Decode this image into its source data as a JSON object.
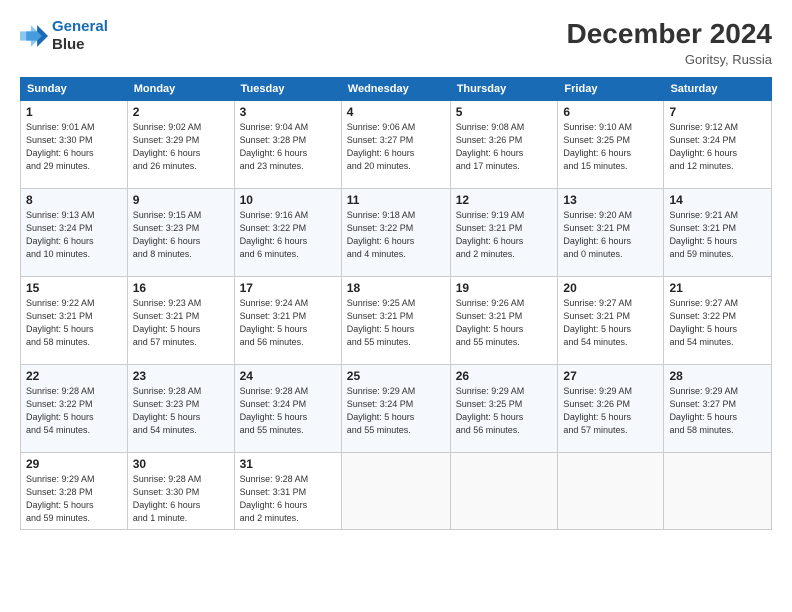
{
  "header": {
    "logo_line1": "General",
    "logo_line2": "Blue",
    "month": "December 2024",
    "location": "Goritsy, Russia"
  },
  "days_of_week": [
    "Sunday",
    "Monday",
    "Tuesday",
    "Wednesday",
    "Thursday",
    "Friday",
    "Saturday"
  ],
  "weeks": [
    [
      {
        "day": "1",
        "info": "Sunrise: 9:01 AM\nSunset: 3:30 PM\nDaylight: 6 hours\nand 29 minutes."
      },
      {
        "day": "2",
        "info": "Sunrise: 9:02 AM\nSunset: 3:29 PM\nDaylight: 6 hours\nand 26 minutes."
      },
      {
        "day": "3",
        "info": "Sunrise: 9:04 AM\nSunset: 3:28 PM\nDaylight: 6 hours\nand 23 minutes."
      },
      {
        "day": "4",
        "info": "Sunrise: 9:06 AM\nSunset: 3:27 PM\nDaylight: 6 hours\nand 20 minutes."
      },
      {
        "day": "5",
        "info": "Sunrise: 9:08 AM\nSunset: 3:26 PM\nDaylight: 6 hours\nand 17 minutes."
      },
      {
        "day": "6",
        "info": "Sunrise: 9:10 AM\nSunset: 3:25 PM\nDaylight: 6 hours\nand 15 minutes."
      },
      {
        "day": "7",
        "info": "Sunrise: 9:12 AM\nSunset: 3:24 PM\nDaylight: 6 hours\nand 12 minutes."
      }
    ],
    [
      {
        "day": "8",
        "info": "Sunrise: 9:13 AM\nSunset: 3:24 PM\nDaylight: 6 hours\nand 10 minutes."
      },
      {
        "day": "9",
        "info": "Sunrise: 9:15 AM\nSunset: 3:23 PM\nDaylight: 6 hours\nand 8 minutes."
      },
      {
        "day": "10",
        "info": "Sunrise: 9:16 AM\nSunset: 3:22 PM\nDaylight: 6 hours\nand 6 minutes."
      },
      {
        "day": "11",
        "info": "Sunrise: 9:18 AM\nSunset: 3:22 PM\nDaylight: 6 hours\nand 4 minutes."
      },
      {
        "day": "12",
        "info": "Sunrise: 9:19 AM\nSunset: 3:21 PM\nDaylight: 6 hours\nand 2 minutes."
      },
      {
        "day": "13",
        "info": "Sunrise: 9:20 AM\nSunset: 3:21 PM\nDaylight: 6 hours\nand 0 minutes."
      },
      {
        "day": "14",
        "info": "Sunrise: 9:21 AM\nSunset: 3:21 PM\nDaylight: 5 hours\nand 59 minutes."
      }
    ],
    [
      {
        "day": "15",
        "info": "Sunrise: 9:22 AM\nSunset: 3:21 PM\nDaylight: 5 hours\nand 58 minutes."
      },
      {
        "day": "16",
        "info": "Sunrise: 9:23 AM\nSunset: 3:21 PM\nDaylight: 5 hours\nand 57 minutes."
      },
      {
        "day": "17",
        "info": "Sunrise: 9:24 AM\nSunset: 3:21 PM\nDaylight: 5 hours\nand 56 minutes."
      },
      {
        "day": "18",
        "info": "Sunrise: 9:25 AM\nSunset: 3:21 PM\nDaylight: 5 hours\nand 55 minutes."
      },
      {
        "day": "19",
        "info": "Sunrise: 9:26 AM\nSunset: 3:21 PM\nDaylight: 5 hours\nand 55 minutes."
      },
      {
        "day": "20",
        "info": "Sunrise: 9:27 AM\nSunset: 3:21 PM\nDaylight: 5 hours\nand 54 minutes."
      },
      {
        "day": "21",
        "info": "Sunrise: 9:27 AM\nSunset: 3:22 PM\nDaylight: 5 hours\nand 54 minutes."
      }
    ],
    [
      {
        "day": "22",
        "info": "Sunrise: 9:28 AM\nSunset: 3:22 PM\nDaylight: 5 hours\nand 54 minutes."
      },
      {
        "day": "23",
        "info": "Sunrise: 9:28 AM\nSunset: 3:23 PM\nDaylight: 5 hours\nand 54 minutes."
      },
      {
        "day": "24",
        "info": "Sunrise: 9:28 AM\nSunset: 3:24 PM\nDaylight: 5 hours\nand 55 minutes."
      },
      {
        "day": "25",
        "info": "Sunrise: 9:29 AM\nSunset: 3:24 PM\nDaylight: 5 hours\nand 55 minutes."
      },
      {
        "day": "26",
        "info": "Sunrise: 9:29 AM\nSunset: 3:25 PM\nDaylight: 5 hours\nand 56 minutes."
      },
      {
        "day": "27",
        "info": "Sunrise: 9:29 AM\nSunset: 3:26 PM\nDaylight: 5 hours\nand 57 minutes."
      },
      {
        "day": "28",
        "info": "Sunrise: 9:29 AM\nSunset: 3:27 PM\nDaylight: 5 hours\nand 58 minutes."
      }
    ],
    [
      {
        "day": "29",
        "info": "Sunrise: 9:29 AM\nSunset: 3:28 PM\nDaylight: 5 hours\nand 59 minutes."
      },
      {
        "day": "30",
        "info": "Sunrise: 9:28 AM\nSunset: 3:30 PM\nDaylight: 6 hours\nand 1 minute."
      },
      {
        "day": "31",
        "info": "Sunrise: 9:28 AM\nSunset: 3:31 PM\nDaylight: 6 hours\nand 2 minutes."
      },
      null,
      null,
      null,
      null
    ]
  ]
}
